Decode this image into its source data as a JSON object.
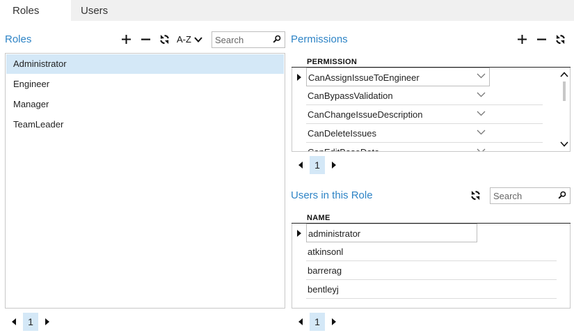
{
  "tabs": [
    {
      "label": "Roles",
      "active": true
    },
    {
      "label": "Users",
      "active": false
    }
  ],
  "roles_panel": {
    "heading": "Roles",
    "sort_label": "A-Z",
    "search_placeholder": "Search",
    "items": [
      "Administrator",
      "Engineer",
      "Manager",
      "TeamLeader"
    ],
    "selected_index": 0,
    "page": "1"
  },
  "permissions_panel": {
    "heading": "Permissions",
    "column_header": "PERMISSION",
    "rows": [
      "CanAssignIssueToEngineer",
      "CanBypassValidation",
      "CanChangeIssueDescription",
      "CanDeleteIssues",
      "CanEditBaseData"
    ],
    "current_index": 0,
    "page": "1"
  },
  "users_panel": {
    "heading": "Users in this Role",
    "search_placeholder": "Search",
    "column_header": "NAME",
    "rows": [
      "administrator",
      "atkinsonl",
      "barrerag",
      "bentleyj"
    ],
    "current_index": 0,
    "page": "1"
  },
  "icons": {
    "add": "plus-icon",
    "remove": "minus-icon",
    "refresh": "refresh-icon",
    "sort": "chevron-down-icon",
    "search": "magnifier-icon",
    "prev": "triangle-left-icon",
    "next": "triangle-right-icon",
    "row_indicator": "triangle-right-icon",
    "dropdown": "chevron-down-icon"
  },
  "colors": {
    "accent": "#2e84c6",
    "selection": "#d4e8f7",
    "tabstrip": "#f0f0f0"
  }
}
